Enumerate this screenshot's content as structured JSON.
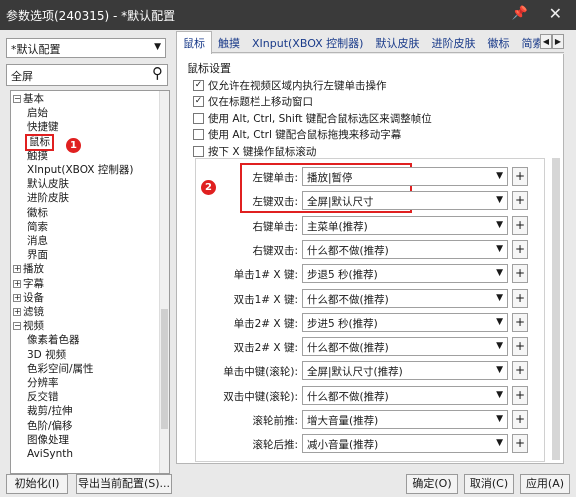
{
  "window": {
    "title": "参数选项(240315) - *默认配置"
  },
  "left": {
    "preset_value": "*默认配置",
    "search_value": "全屏",
    "tree": [
      {
        "label": "基本",
        "toggle": "−",
        "level": 0
      },
      {
        "label": "启始",
        "level": 1
      },
      {
        "label": "快捷键",
        "level": 1
      },
      {
        "label": "鼠标",
        "level": 1,
        "selected": true
      },
      {
        "label": "触摸",
        "level": 1
      },
      {
        "label": "XInput(XBOX 控制器)",
        "level": 1
      },
      {
        "label": "默认皮肤",
        "level": 1
      },
      {
        "label": "进阶皮肤",
        "level": 1
      },
      {
        "label": "徽标",
        "level": 1
      },
      {
        "label": "简索",
        "level": 1
      },
      {
        "label": "消息",
        "level": 1
      },
      {
        "label": "界面",
        "level": 1
      },
      {
        "label": "播放",
        "toggle": "+",
        "level": 0
      },
      {
        "label": "字幕",
        "toggle": "+",
        "level": 0
      },
      {
        "label": "设备",
        "toggle": "+",
        "level": 0
      },
      {
        "label": "滤镜",
        "toggle": "+",
        "level": 0
      },
      {
        "label": "视频",
        "toggle": "−",
        "level": 0
      },
      {
        "label": "像素着色器",
        "level": 1
      },
      {
        "label": "3D 视频",
        "level": 1
      },
      {
        "label": "色彩空间/属性",
        "level": 1
      },
      {
        "label": "分辨率",
        "level": 1
      },
      {
        "label": "反交错",
        "level": 1
      },
      {
        "label": "裁剪/拉伸",
        "level": 1
      },
      {
        "label": "色阶/偏移",
        "level": 1
      },
      {
        "label": "图像处理",
        "level": 1
      },
      {
        "label": "AviSynth",
        "level": 1
      }
    ]
  },
  "badges": {
    "one": "1",
    "two": "2"
  },
  "tabs": [
    "鼠标",
    "触摸",
    "XInput(XBOX 控制器)",
    "默认皮肤",
    "进阶皮肤",
    "徽标",
    "简索"
  ],
  "panel": {
    "group_label": "鼠标设置",
    "checkboxes": [
      {
        "label": "仅允许在视频区域内执行左键单击操作",
        "checked": true
      },
      {
        "label": "仅在标题栏上移动窗口",
        "checked": true
      },
      {
        "label": "使用 Alt, Ctrl, Shift 键配合鼠标选区来调整帧位",
        "checked": false
      },
      {
        "label": "使用 Alt, Ctrl 键配合鼠标拖拽来移动字幕",
        "checked": false
      },
      {
        "label": "按下 X 键操作鼠标滚动",
        "checked": false
      }
    ],
    "mappings": [
      {
        "label": "左键单击:",
        "value": "播放|暂停"
      },
      {
        "label": "左键双击:",
        "value": "全屏|默认尺寸"
      },
      {
        "label": "右键单击:",
        "value": "主菜单(推荐)"
      },
      {
        "label": "右键双击:",
        "value": "什么都不做(推荐)"
      },
      {
        "label": "单击1# X 键:",
        "value": "步退5 秒(推荐)"
      },
      {
        "label": "双击1# X 键:",
        "value": "什么都不做(推荐)"
      },
      {
        "label": "单击2# X 键:",
        "value": "步进5 秒(推荐)"
      },
      {
        "label": "双击2# X 键:",
        "value": "什么都不做(推荐)"
      },
      {
        "label": "单击中键(滚轮):",
        "value": "全屏|默认尺寸(推荐)"
      },
      {
        "label": "双击中键(滚轮):",
        "value": "什么都不做(推荐)"
      },
      {
        "label": "滚轮前推:",
        "value": "增大音量(推荐)"
      },
      {
        "label": "滚轮后推:",
        "value": "减小音量(推荐)"
      }
    ],
    "plus_label": "+"
  },
  "buttons": {
    "init": "初始化(I)",
    "export": "导出当前配置(S)...",
    "ok": "确定(O)",
    "cancel": "取消(C)",
    "apply": "应用(A)"
  },
  "colors": {
    "title_bar": "#3a3a3a",
    "annotation_red": "#e02020",
    "tab_text": "#1a3b8a"
  }
}
